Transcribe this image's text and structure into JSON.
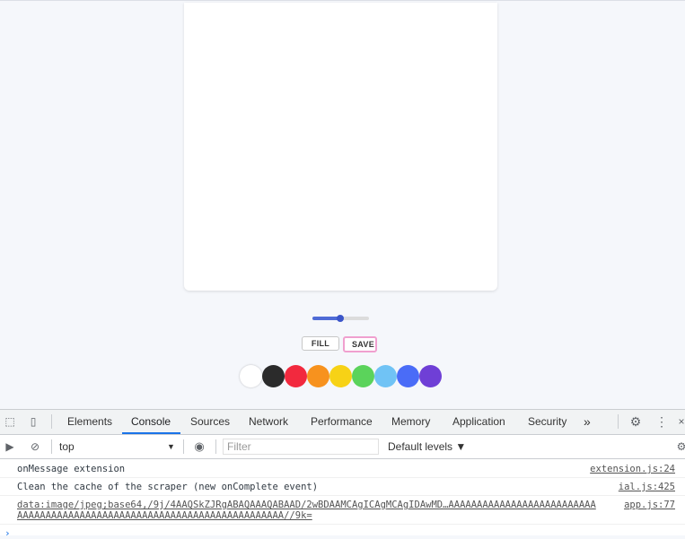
{
  "buttons": {
    "fill": "FILL",
    "save": "SAVE"
  },
  "slider": {
    "value_fraction": 0.49
  },
  "palette": [
    {
      "name": "white",
      "color": "#ffffff"
    },
    {
      "name": "black",
      "color": "#2b2b2b"
    },
    {
      "name": "red",
      "color": "#f2293e"
    },
    {
      "name": "orange",
      "color": "#f7921e"
    },
    {
      "name": "yellow",
      "color": "#f7d216"
    },
    {
      "name": "green",
      "color": "#5bd35b"
    },
    {
      "name": "light-blue",
      "color": "#70c3f5"
    },
    {
      "name": "blue",
      "color": "#4a6cf7"
    },
    {
      "name": "purple",
      "color": "#6f3fd6"
    }
  ],
  "devtools": {
    "tabs": [
      "Elements",
      "Console",
      "Sources",
      "Network",
      "Performance",
      "Memory",
      "Application",
      "Security"
    ],
    "active_tab": "Console",
    "more": "»",
    "context": "top",
    "filter_placeholder": "Filter",
    "levels": "Default levels ▼",
    "logs": [
      {
        "message": "onMessage extension",
        "source": "extension.js:24"
      },
      {
        "message": "Clean the cache of the scraper (new onComplete event)",
        "source": "ial.js:425"
      },
      {
        "message": "data:image/jpeg;base64,/9j/4AAQSkZJRgABAQAAAQABAAD/2wBDAAMCAgICAgMCAgIDAwMD…AAAAAAAAAAAAAAAAAAAAAAAAAA",
        "message2": "AAAAAAAAAAAAAAAAAAAAAAAAAAAAAAAAAAAAAAAAAAAAAAA//9k=",
        "source": "app.js:77"
      }
    ],
    "prompt": "›"
  }
}
